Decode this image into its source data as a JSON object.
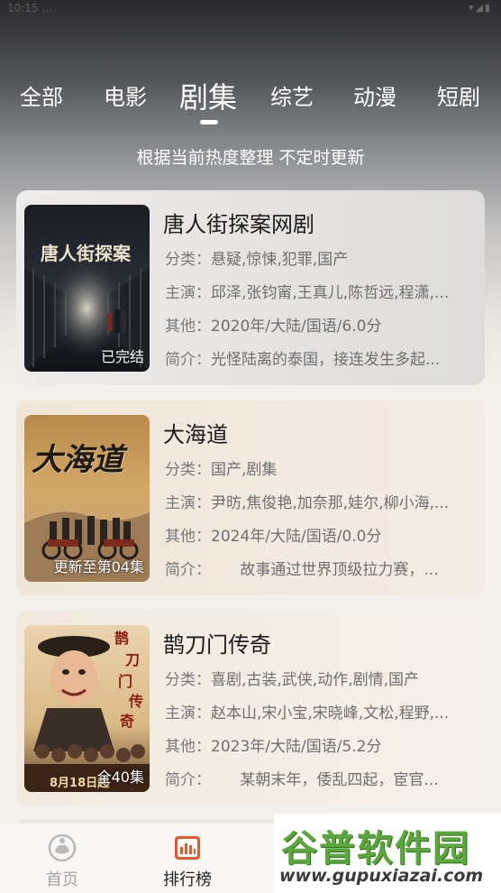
{
  "statusbar": {
    "time": "10:15 …",
    "icons": "▾◢▮"
  },
  "tabs": [
    {
      "label": "全部",
      "active": false
    },
    {
      "label": "电影",
      "active": false
    },
    {
      "label": "剧集",
      "active": true
    },
    {
      "label": "综艺",
      "active": false
    },
    {
      "label": "动漫",
      "active": false
    },
    {
      "label": "短剧",
      "active": false
    }
  ],
  "subtitle": "根据当前热度整理 不定时更新",
  "labels": {
    "category": "分类：",
    "cast": "主演：",
    "other": "其他：",
    "intro": "简介："
  },
  "items": [
    {
      "title": "唐人街探案网剧",
      "badge": "已完结",
      "poster_text": "唐人街探案",
      "category": "悬疑,惊悚,犯罪,国产",
      "cast": "邱泽,张钧甯,王真儿,陈哲远,程潇,...",
      "other": "2020年/大陆/国语/6.0分",
      "intro": "光怪陆离的泰国，接连发生多起..."
    },
    {
      "title": "大海道",
      "badge": "更新至第04集",
      "poster_text": "大海道",
      "category": "国产,剧集",
      "cast": "尹昉,焦俊艳,加奈那,娃尔,柳小海,...",
      "other": "2024年/大陆/国语/0.0分",
      "intro": "      故事通过世界顶级拉力赛，..."
    },
    {
      "title": "鹊刀门传奇",
      "badge": "全40集",
      "poster_text": "8月18日起",
      "category": "喜剧,古装,武侠,动作,剧情,国产",
      "cast": "赵本山,宋小宝,宋晓峰,文松,程野,...",
      "other": "2023年/大陆/国语/5.2分",
      "intro": "      某朝末年，倭乱四起，宦官..."
    }
  ],
  "bottom_nav": [
    {
      "label": "首页",
      "icon": "home-icon",
      "active": false
    },
    {
      "label": "排行榜",
      "icon": "ranking-icon",
      "active": true
    }
  ],
  "watermark": {
    "logo": "谷普软件园",
    "url": "www.gupuxiazai.com"
  },
  "colors": {
    "accent": "#e9572b",
    "active_text": "#222222",
    "inactive_text": "#a7a7a7"
  }
}
